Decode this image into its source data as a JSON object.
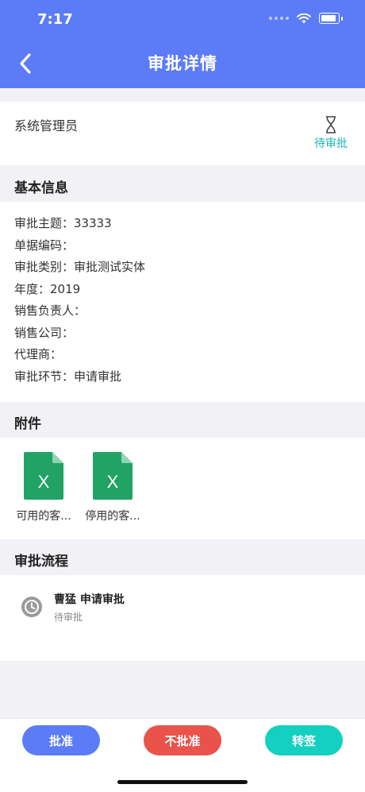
{
  "status_bar": {
    "time": "7:17"
  },
  "nav": {
    "title": "审批详情"
  },
  "user": {
    "name": "系统管理员",
    "status": "待审批",
    "status_color": "#18b6b0"
  },
  "sections": {
    "basic": "基本信息",
    "attachments": "附件",
    "flow": "审批流程"
  },
  "info": [
    "审批主题：33333",
    "单据编码：",
    "审批类别：审批测试实体",
    "年度：2019",
    "销售负责人：",
    "销售公司：",
    "代理商：",
    "审批环节：申请审批"
  ],
  "attachments": [
    {
      "icon": "excel-file-icon",
      "name": "可用的客..."
    },
    {
      "icon": "excel-file-icon",
      "name": "停用的客..."
    }
  ],
  "flow": {
    "title": "曹猛 申请审批",
    "status": "待审批",
    "icon": "clock-icon"
  },
  "actions": {
    "approve": "批准",
    "reject": "不批准",
    "transfer": "转签"
  },
  "colors": {
    "header": "#5b7cf6",
    "approve": "#5b7cf6",
    "reject": "#e9534b",
    "transfer": "#14d0c0",
    "excel": "#21a366"
  }
}
